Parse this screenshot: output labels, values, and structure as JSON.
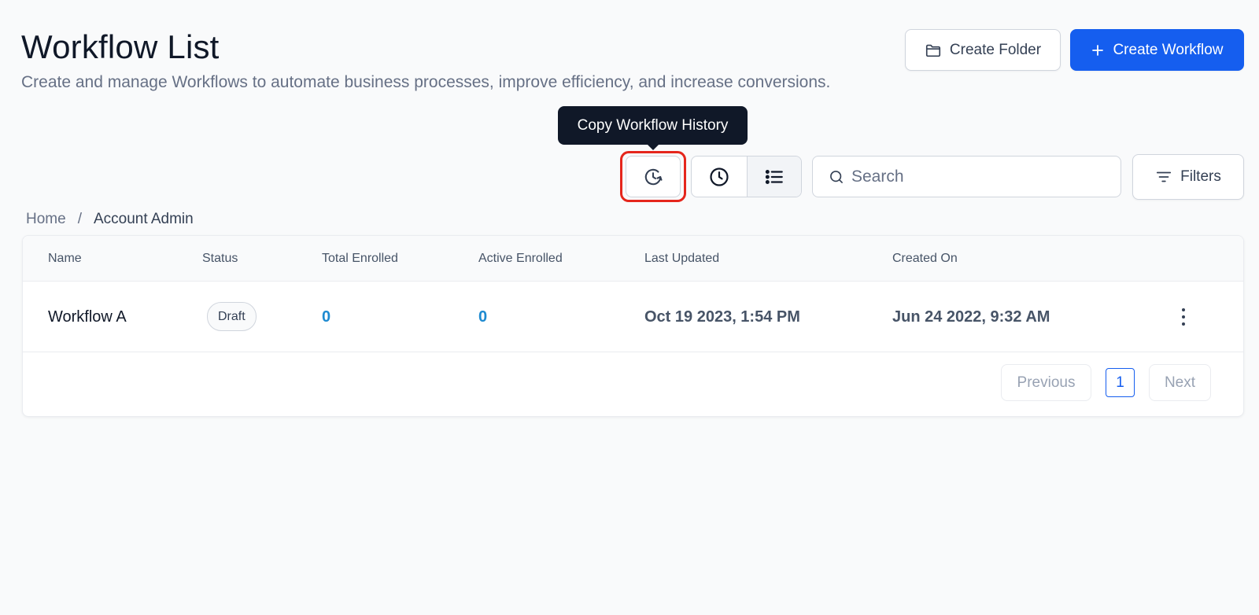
{
  "header": {
    "title": "Workflow List",
    "subtitle": "Create and manage Workflows to automate business processes, improve efficiency, and increase conversions.",
    "create_folder_label": "Create Folder",
    "create_workflow_label": "Create Workflow"
  },
  "toolbar": {
    "tooltip": "Copy Workflow History",
    "search_placeholder": "Search",
    "filters_label": "Filters",
    "active_view": "list"
  },
  "breadcrumb": {
    "items": [
      "Home",
      "Account Admin"
    ],
    "separator": "/"
  },
  "table": {
    "columns": [
      "Name",
      "Status",
      "Total Enrolled",
      "Active Enrolled",
      "Last Updated",
      "Created On"
    ],
    "rows": [
      {
        "name": "Workflow A",
        "status": "Draft",
        "total_enrolled": "0",
        "active_enrolled": "0",
        "last_updated": "Oct 19 2023, 1:54 PM",
        "created_on": "Jun 24 2022, 9:32 AM"
      }
    ]
  },
  "pagination": {
    "previous_label": "Previous",
    "current_page": "1",
    "next_label": "Next"
  },
  "colors": {
    "primary": "#155eef",
    "highlight": "#e5261c",
    "tooltip_bg": "#101828",
    "link_number": "#1d8ad0"
  }
}
